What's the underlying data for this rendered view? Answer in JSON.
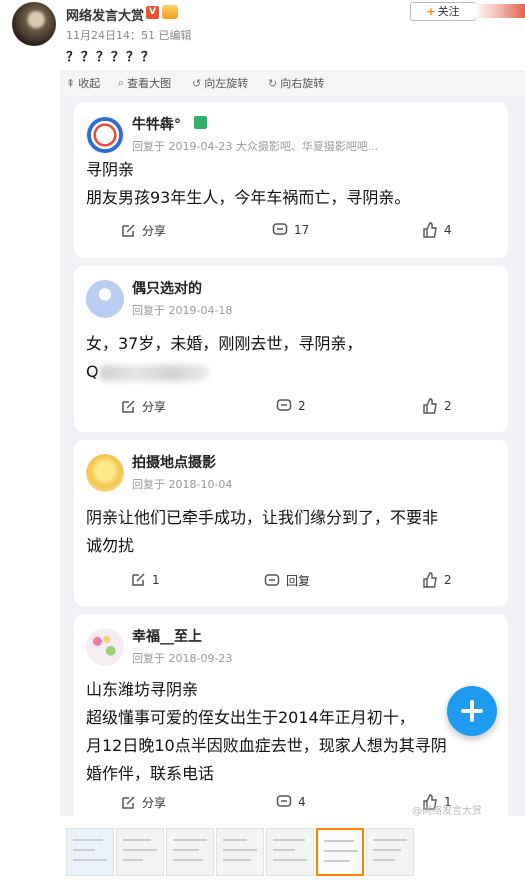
{
  "post": {
    "author": "网络发言大赏",
    "verify_badge": "V",
    "meta": "11月24日14：51   已编辑",
    "follow_label": "关注",
    "text": "？？？？？？"
  },
  "toolbar": {
    "collapse": "收起",
    "view_large": "查看大图",
    "rotate_left": "向左旋转",
    "rotate_right": "向右旋转"
  },
  "comments": [
    {
      "name": "牛牪犇°",
      "reply": "回复于 2019-04-23   大众摄影吧、华夏摄影吧吧...",
      "body": [
        "寻阴亲",
        "朋友男孩93年生人，今年车祸而亡，寻阴亲。"
      ],
      "share": "分享",
      "comments": "17",
      "likes": "4"
    },
    {
      "name": "偶只选对的",
      "reply": "回复于 2019-04-18",
      "body": [
        "女，37岁，未婚，刚刚去世，寻阴亲，",
        "Q"
      ],
      "share": "分享",
      "comments": "2",
      "likes": "2"
    },
    {
      "name": "拍摄地点摄影",
      "reply": "回复于 2018-10-04",
      "body": [
        "阴亲让他们已牵手成功，让我们缘分到了，不要非",
        "诚勿扰"
      ],
      "share": "1",
      "comments": "回复",
      "likes": "2"
    },
    {
      "name": "幸福__至上",
      "reply": "回复于 2018-09-23",
      "body": [
        "山东潍坊寻阴亲",
        "超级懂事可爱的侄女出生于2014年正月初十，",
        "月12日晚10点半因败血症去世，现家人想为其寻阴",
        "婚作伴，联系电话"
      ],
      "share": "分享",
      "comments": "4",
      "likes": "1"
    }
  ],
  "watermark": "@网络发言大赏",
  "colors": {
    "accent": "#ff8200",
    "fab": "#1d9bf0",
    "verified": "#e8542e"
  }
}
